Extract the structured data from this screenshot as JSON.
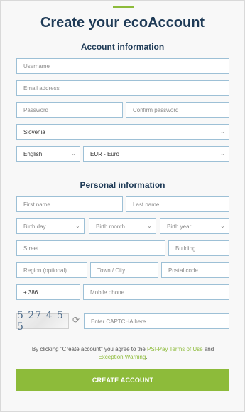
{
  "page": {
    "title": "Create your ecoAccount"
  },
  "sections": {
    "account": "Account information",
    "personal": "Personal information"
  },
  "fields": {
    "username": "Username",
    "email": "Email address",
    "password": "Password",
    "confirm_password": "Confirm password",
    "country": "Slovenia",
    "language": "English",
    "currency": "EUR - Euro",
    "first_name": "First name",
    "last_name": "Last name",
    "birth_day": "Birth day",
    "birth_month": "Birth month",
    "birth_year": "Birth year",
    "street": "Street",
    "building": "Building",
    "region": "Region (optional)",
    "town": "Town / City",
    "postal": "Postal code",
    "phone_prefix": "+ 386",
    "mobile": "Mobile phone",
    "captcha_text": "5 27 4 5 5",
    "captcha_input": "Enter CAPTCHA here"
  },
  "terms": {
    "prefix": "By clicking \"Create account\" you agree to the",
    "link1": "PSI-Pay Terms of Use",
    "and": "and",
    "link2": "Exception Warning",
    "suffix": "."
  },
  "submit_label": "CREATE ACCOUNT",
  "colors": {
    "accent": "#8dbb3a",
    "heading": "#1f3b57",
    "field_border": "#9dc0d6"
  },
  "icons": {
    "select": "chevron-down-icon",
    "refresh": "refresh-icon"
  }
}
